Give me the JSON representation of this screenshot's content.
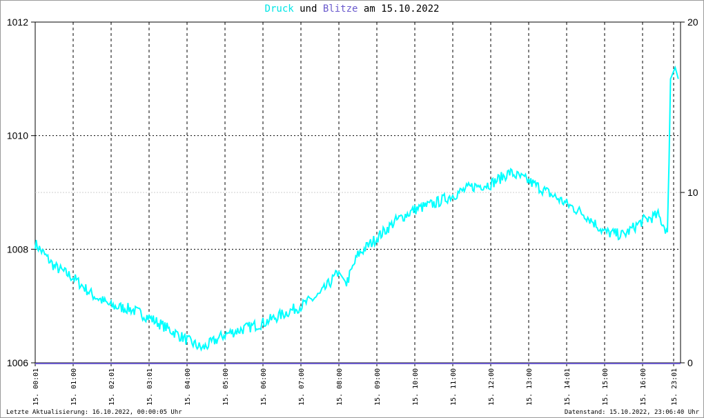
{
  "title": {
    "part1": "Druck",
    "part2": " und ",
    "part3": "Blitze",
    "part4": " am 15.10.2022",
    "color1": "#00e5e5",
    "color3": "#6a5acd"
  },
  "footer": {
    "left": "Letzte Aktualisierung: 16.10.2022, 00:00:05 Uhr",
    "right": "Datenstand: 15.10.2022, 23:06:40 Uhr"
  },
  "chart_data": {
    "type": "line",
    "title": "Druck und Blitze am 15.10.2022",
    "left_axis": {
      "label": "Druck",
      "ticks": [
        "1006",
        "1008",
        "1010",
        "1012"
      ],
      "range": [
        1006,
        1012
      ]
    },
    "right_axis": {
      "label": "Blitze",
      "ticks": [
        "0",
        "10",
        "20"
      ],
      "range": [
        0,
        20
      ]
    },
    "x_ticks": [
      "15. 00:01",
      "15. 01:00",
      "15. 02:01",
      "15. 03:01",
      "15. 04:00",
      "15. 05:00",
      "15. 06:00",
      "15. 07:00",
      "15. 08:00",
      "15. 09:00",
      "15. 10:00",
      "15. 11:00",
      "15. 12:00",
      "15. 13:00",
      "15. 14:01",
      "15. 15:00",
      "15. 16:00",
      "15. 23:01"
    ],
    "series": [
      {
        "name": "Druck",
        "color": "#00ffff",
        "axis": "left",
        "x": [
          0,
          0.5,
          1,
          1.5,
          2,
          2.5,
          3,
          3.5,
          4,
          4.4,
          5,
          5.5,
          6,
          6.5,
          7,
          7.5,
          8,
          8.2,
          8.5,
          9,
          9.5,
          10,
          10.5,
          11,
          11.5,
          12,
          12.5,
          13,
          13.5,
          14,
          14.5,
          15,
          15.5,
          16,
          16.5,
          16.8,
          16.85,
          16.9,
          17.05,
          17.15
        ],
        "values": [
          1008.1,
          1007.7,
          1007.5,
          1007.2,
          1007.0,
          1006.95,
          1006.8,
          1006.6,
          1006.4,
          1006.25,
          1006.5,
          1006.6,
          1006.7,
          1006.85,
          1007.0,
          1007.2,
          1007.6,
          1007.4,
          1007.9,
          1008.2,
          1008.5,
          1008.7,
          1008.8,
          1008.95,
          1009.1,
          1009.15,
          1009.35,
          1009.2,
          1009.0,
          1008.8,
          1008.6,
          1008.3,
          1008.25,
          1008.5,
          1008.6,
          1008.3,
          1009.5,
          1011.0,
          1011.2,
          1011.0
        ]
      },
      {
        "name": "Blitze",
        "color": "#6a5acd",
        "axis": "right",
        "x": [
          0,
          17.15
        ],
        "values": [
          0,
          0
        ]
      }
    ],
    "grid": true
  }
}
